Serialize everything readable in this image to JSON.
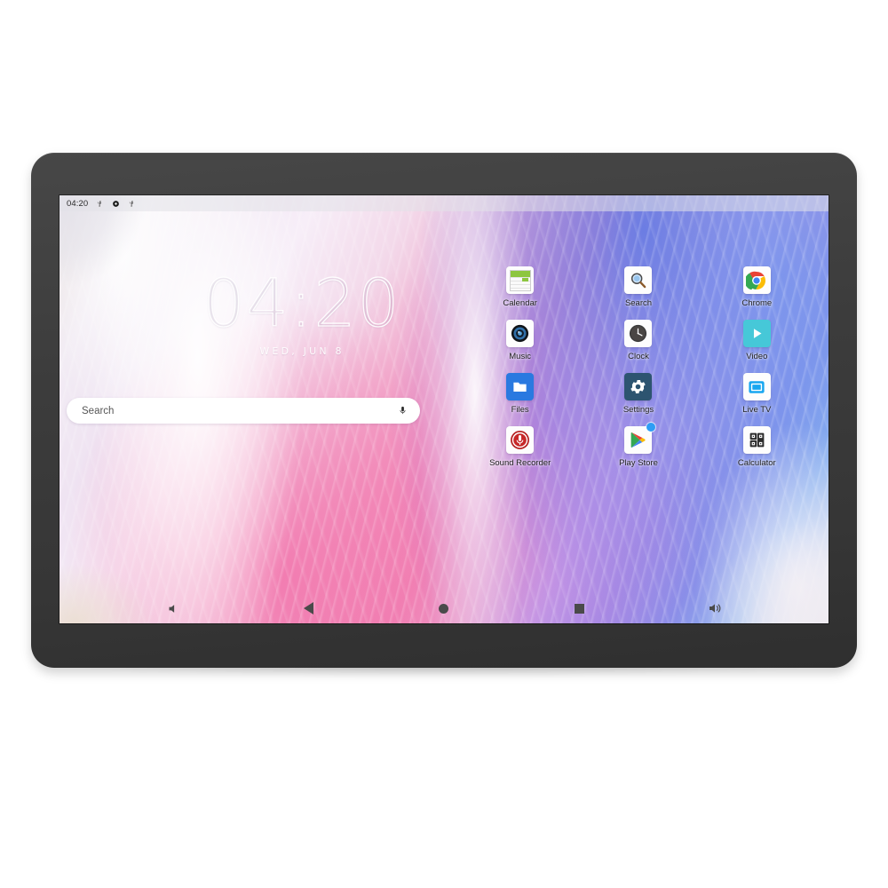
{
  "device": {
    "name": "Android tablet",
    "bezel_color": "#3c3c3c"
  },
  "status_bar": {
    "clock": "04:20",
    "icons": [
      "usb-icon",
      "location-icon",
      "usb-debug-icon"
    ]
  },
  "clock_widget": {
    "time": "04:20",
    "date": "WED, JUN 8"
  },
  "search": {
    "placeholder": "Search",
    "value": "",
    "mic_icon": "microphone-icon"
  },
  "app_grid": {
    "apps": [
      {
        "label": "Calendar",
        "icon": "calendar-icon"
      },
      {
        "label": "Search",
        "icon": "magnifier-icon"
      },
      {
        "label": "Chrome",
        "icon": "chrome-icon"
      },
      {
        "label": "Music",
        "icon": "music-speaker-icon"
      },
      {
        "label": "Clock",
        "icon": "analog-clock-icon"
      },
      {
        "label": "Video",
        "icon": "video-play-icon"
      },
      {
        "label": "Files",
        "icon": "folder-icon"
      },
      {
        "label": "Settings",
        "icon": "gear-icon"
      },
      {
        "label": "Live TV",
        "icon": "tv-icon"
      },
      {
        "label": "Sound Recorder",
        "icon": "record-mic-icon"
      },
      {
        "label": "Play Store",
        "icon": "play-store-icon",
        "badge": true
      },
      {
        "label": "Calculator",
        "icon": "calculator-keypad-icon"
      }
    ]
  },
  "nav_bar": {
    "buttons": [
      {
        "name": "volume-down",
        "icon": "volume-down-icon"
      },
      {
        "name": "back",
        "icon": "triangle-back-icon"
      },
      {
        "name": "home",
        "icon": "circle-home-icon"
      },
      {
        "name": "recents",
        "icon": "square-recents-icon"
      },
      {
        "name": "volume-up",
        "icon": "volume-up-icon"
      }
    ]
  },
  "colors": {
    "accent_blue": "#2e9df5",
    "calendar_green": "#8dc63f",
    "video_teal": "#46c8d8",
    "files_blue": "#2a79e0",
    "settings_navy": "#2d5470",
    "recorder_red": "#c62828"
  }
}
